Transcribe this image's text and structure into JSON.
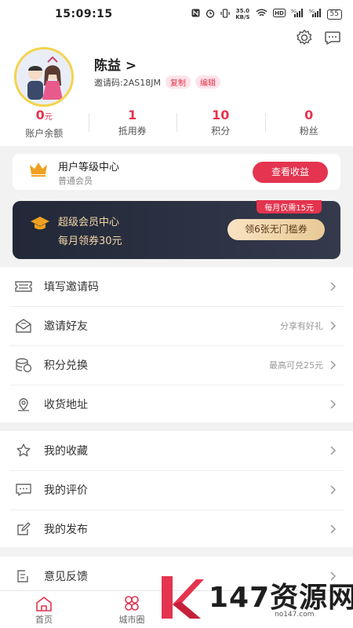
{
  "status_bar": {
    "time": "15:09:15",
    "net_speed": "35.0",
    "net_unit": "KB/S",
    "battery": "55"
  },
  "profile": {
    "username": "陈益 >",
    "invite_label": "邀请码:",
    "invite_code": "2AS18JM",
    "copy_label": "复制",
    "edit_label": "编辑",
    "stats": [
      {
        "value": "0",
        "unit": "元",
        "label": "账户余额"
      },
      {
        "value": "1",
        "unit": "",
        "label": "抵用券"
      },
      {
        "value": "10",
        "unit": "",
        "label": "积分"
      },
      {
        "value": "0",
        "unit": "",
        "label": "粉丝"
      }
    ]
  },
  "level_card": {
    "title": "用户等级中心",
    "subtitle": "普通会员",
    "button": "查看收益"
  },
  "vip_card": {
    "title": "超级会员中心",
    "subtitle": "每月领券30元",
    "badge": "每月仅需15元",
    "button": "领6张无门槛券"
  },
  "menu_group_1": [
    {
      "label": "填写邀请码",
      "hint": ""
    },
    {
      "label": "邀请好友",
      "hint": "分享有好礼"
    },
    {
      "label": "积分兑换",
      "hint": "最高可兑25元"
    },
    {
      "label": "收货地址",
      "hint": ""
    }
  ],
  "menu_group_2": [
    {
      "label": "我的收藏"
    },
    {
      "label": "我的评价"
    },
    {
      "label": "我的发布"
    }
  ],
  "menu_group_3": [
    {
      "label": "意见反馈"
    }
  ],
  "tabbar": {
    "tab1": "首页",
    "tab2": "城市圈"
  },
  "watermark": {
    "text": "147资源网",
    "url": "no147.com"
  },
  "colors": {
    "accent": "#e4344f",
    "gold": "#f1d7a8",
    "vip_bg": "#2a2f40"
  },
  "icons": [
    "settings-icon",
    "message-icon",
    "crown-icon",
    "graduation-cap-icon",
    "ticket-icon",
    "envelope-icon",
    "coins-icon",
    "location-icon",
    "star-icon",
    "comment-icon",
    "edit-icon",
    "feedback-icon",
    "home-icon",
    "city-circle-icon"
  ]
}
